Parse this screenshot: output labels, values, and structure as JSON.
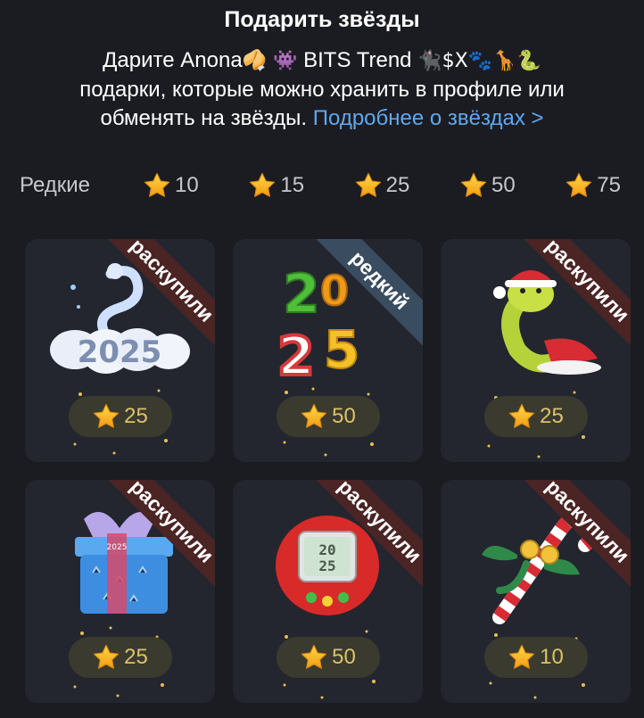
{
  "header": {
    "title": "Подарить звёзды",
    "line1_prefix": "Дарите Anona",
    "line1_emoji_a": "🥠 👾",
    "line1_mid": "BITS Trend",
    "line1_emoji_b": "🐈‍⬛$X🐾🦒🐍",
    "line2": "подарки, которые можно хранить в профиле или",
    "line3": "обменять на звёзды.",
    "link": "Подробнее о звёздах >"
  },
  "filters": [
    {
      "label": "Редкие"
    },
    {
      "value": "10"
    },
    {
      "value": "15"
    },
    {
      "value": "25"
    },
    {
      "value": "50"
    },
    {
      "value": "75"
    }
  ],
  "gifts": [
    {
      "name": "2025 snake on clouds",
      "ribbon": "раскупили",
      "price": "25"
    },
    {
      "name": "2025 candy numbers",
      "ribbon": "редкий",
      "price": "50"
    },
    {
      "name": "snake in santa hat",
      "ribbon": "раскупили",
      "price": "25"
    },
    {
      "name": "2025 gift box",
      "ribbon": "раскупили",
      "price": "25"
    },
    {
      "name": "2025 tamagotchi",
      "ribbon": "раскупили",
      "price": "50"
    },
    {
      "name": "candy cane with bow",
      "ribbon": "раскупили",
      "price": "10"
    }
  ],
  "colors": {
    "background": "#1b1c22",
    "card": "#23262f",
    "link": "#5ea8f0",
    "sold_ribbon": "#4b2424",
    "rare_ribbon": "#3a4d60",
    "price_text": "#d9c36a",
    "star": "#f6b21e"
  }
}
